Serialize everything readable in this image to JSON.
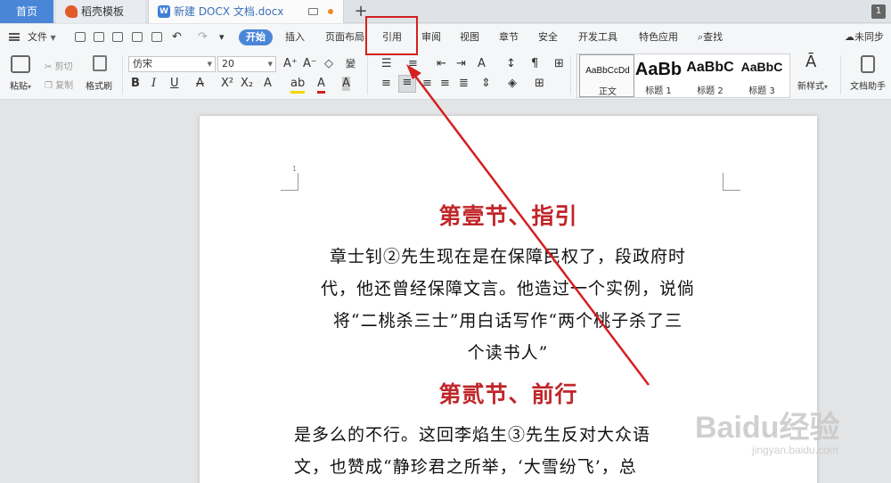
{
  "tabs": {
    "home": "首页",
    "template": "稻壳模板",
    "doc": "新建 DOCX 文档.docx",
    "new_tab": "+",
    "window_count": "1"
  },
  "menu": {
    "file": "文件",
    "items": [
      "开始",
      "插入",
      "页面布局",
      "引用",
      "审阅",
      "视图",
      "章节",
      "安全",
      "开发工具",
      "特色应用"
    ],
    "active_index": 0,
    "search": "查找",
    "sync": "未同步"
  },
  "ribbon": {
    "paste": "粘贴",
    "cut": "剪切",
    "copy": "复制",
    "format_painter": "格式刷",
    "font_name": "仿宋",
    "font_size": "20",
    "styles": [
      {
        "sample": "AaBbCcDd",
        "label": "正文"
      },
      {
        "sample": "AaBb",
        "label": "标题 1"
      },
      {
        "sample": "AaBbC",
        "label": "标题 2"
      },
      {
        "sample": "AaBbC",
        "label": "标题 3"
      }
    ],
    "new_style": "新样式",
    "doc_assistant": "文档助手"
  },
  "document": {
    "page_number": "1",
    "heading1": "第壹节、指引",
    "para1_lines": [
      "章士钊②先生现在是在保障民权了，段政府时",
      "代，他还曾经保障文言。他造过一个实例，说倘",
      "将“二桃杀三士”用白话写作“两个桃子杀了三",
      "个读书人”"
    ],
    "heading2": "第贰节、前行",
    "para2_lines": [
      "是多么的不行。这回李焰生③先生反对大众语",
      "文，也赞成“静珍君之所举，‘大雪纷飞’，总"
    ]
  },
  "annotation": {
    "highlighted_item": "引用",
    "color": "#d42020"
  },
  "watermark": {
    "brand": "Baidu经验",
    "url": "jingyan.baidu.com"
  }
}
